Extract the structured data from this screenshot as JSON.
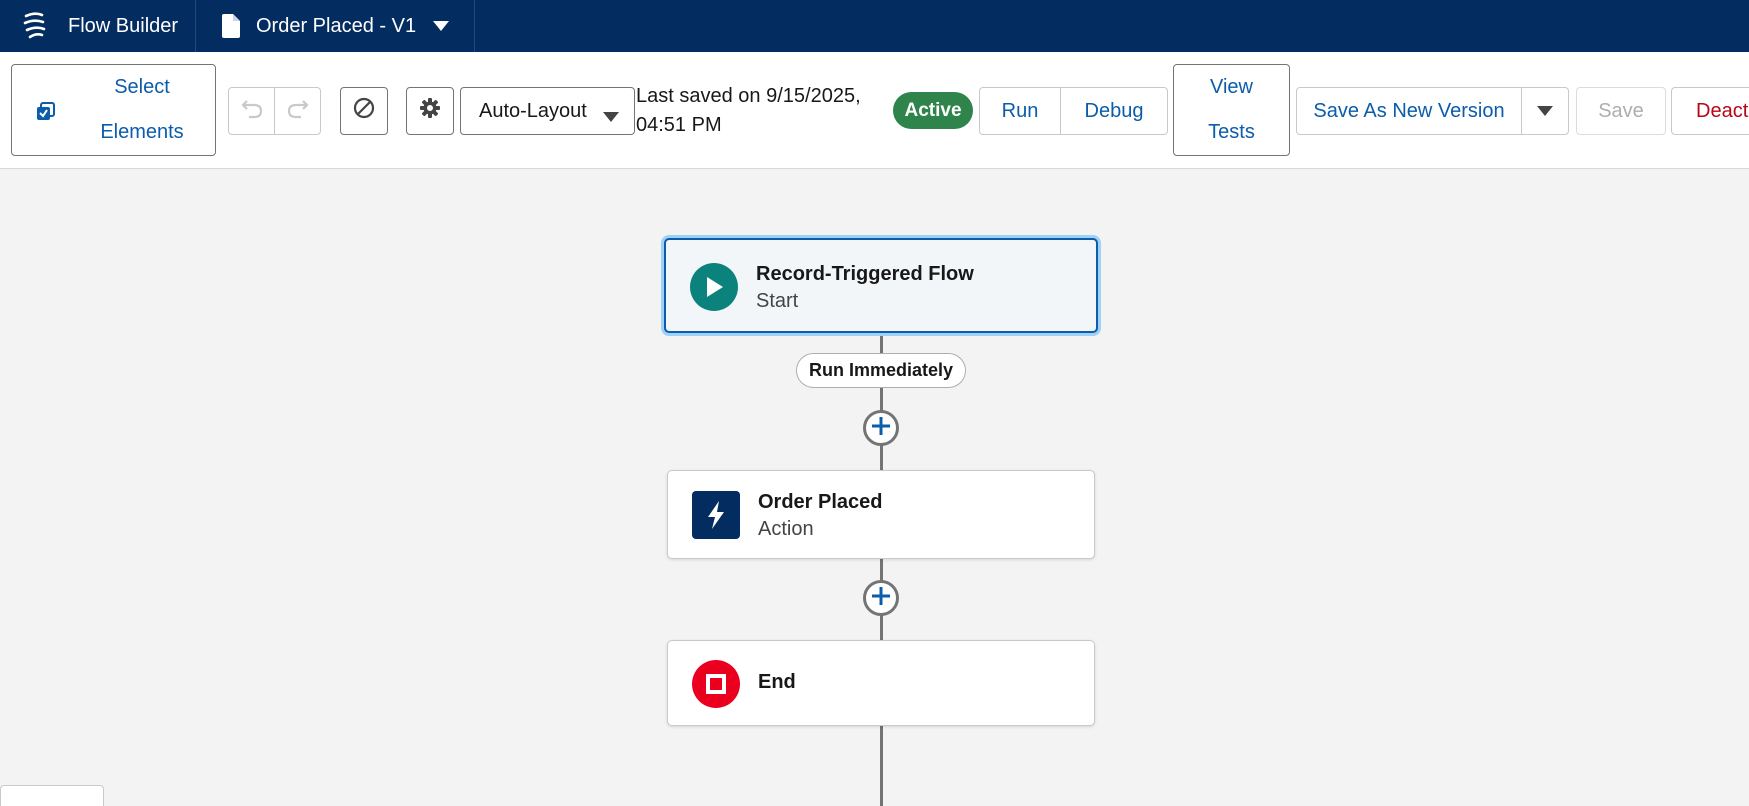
{
  "app": {
    "title": "Flow Builder",
    "flow_name": "Order Placed - V1"
  },
  "toolbar": {
    "select_elements_line1": "Select",
    "select_elements_line2": "Elements",
    "layout_mode": "Auto-Layout",
    "last_saved_line1": "Last saved on 9/15/2025,",
    "last_saved_line2": "04:51 PM",
    "status": "Active",
    "run_label": "Run",
    "debug_label": "Debug",
    "view_tests_line1": "View",
    "view_tests_line2": "Tests",
    "save_new_version_label": "Save As New Version",
    "save_label": "Save",
    "deactivate_label": "Deacti"
  },
  "canvas": {
    "start": {
      "title": "Record-Triggered Flow",
      "subtitle": "Start"
    },
    "path_label": "Run Immediately",
    "action": {
      "title": "Order Placed",
      "subtitle": "Action"
    },
    "end": {
      "title": "End"
    }
  },
  "colors": {
    "appbar": "#032d60",
    "brand_blue": "#0b5cab",
    "active_green": "#2e844a",
    "start_icon": "#0b827c",
    "action_icon": "#032d60",
    "end_icon": "#ea001e",
    "deactivate_red": "#ba0517"
  },
  "icons": [
    "flow-logo-icon",
    "document-icon",
    "chevron-down-icon",
    "select-elements-icon",
    "undo-icon",
    "redo-icon",
    "no-entry-icon",
    "gear-icon",
    "play-icon",
    "lightning-icon",
    "stop-icon",
    "add-icon"
  ]
}
